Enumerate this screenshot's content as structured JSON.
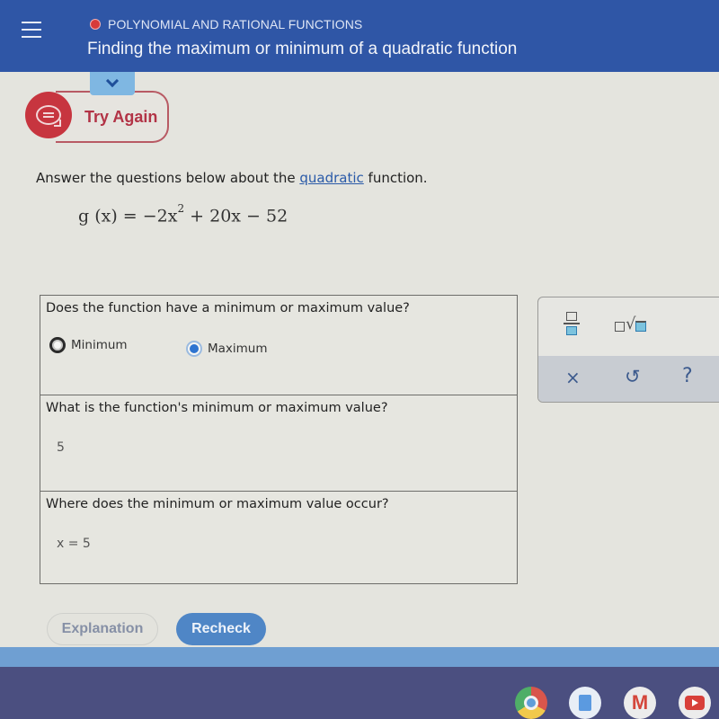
{
  "header": {
    "menu_icon": "hamburger-menu-icon",
    "topic": "POLYNOMIAL AND RATIONAL FUNCTIONS",
    "topic_status_color": "#d63a3a",
    "title": "Finding the maximum or minimum of a quadratic function"
  },
  "feedback": {
    "collapse_icon": "chevron-down-icon",
    "try_again_icon": "chat-bubble-icon",
    "try_again_label": "Try Again"
  },
  "problem": {
    "instruction_prefix": "Answer the questions below about the ",
    "instruction_link": "quadratic",
    "instruction_suffix": " function.",
    "equation_lhs": "g (x) = −2x",
    "equation_exponent": "2",
    "equation_rhs": " + 20x − 52"
  },
  "questions": [
    {
      "prompt": "Does the function have a minimum or maximum value?",
      "options": [
        {
          "label": "Minimum",
          "selected": false
        },
        {
          "label": "Maximum",
          "selected": true
        }
      ]
    },
    {
      "prompt": "What is the function's minimum or maximum value?",
      "answer": "5"
    },
    {
      "prompt": "Where does the minimum or maximum value occur?",
      "answer": "x = 5"
    }
  ],
  "keypad": {
    "keys": [
      "fraction-icon",
      "nth-root-icon"
    ],
    "clear_symbol": "×",
    "undo_symbol": "↺",
    "help_symbol": "?"
  },
  "actions": {
    "explanation_label": "Explanation",
    "recheck_label": "Recheck"
  },
  "shelf": {
    "apps": [
      "chrome-icon",
      "files-icon",
      "gmail-icon",
      "youtube-icon"
    ],
    "gmail_glyph": "M"
  },
  "colors": {
    "header_bg": "#2f56a6",
    "try_again": "#c7353f",
    "recheck_bg": "#4f86c6",
    "radio_selected": "#2e74d0"
  }
}
